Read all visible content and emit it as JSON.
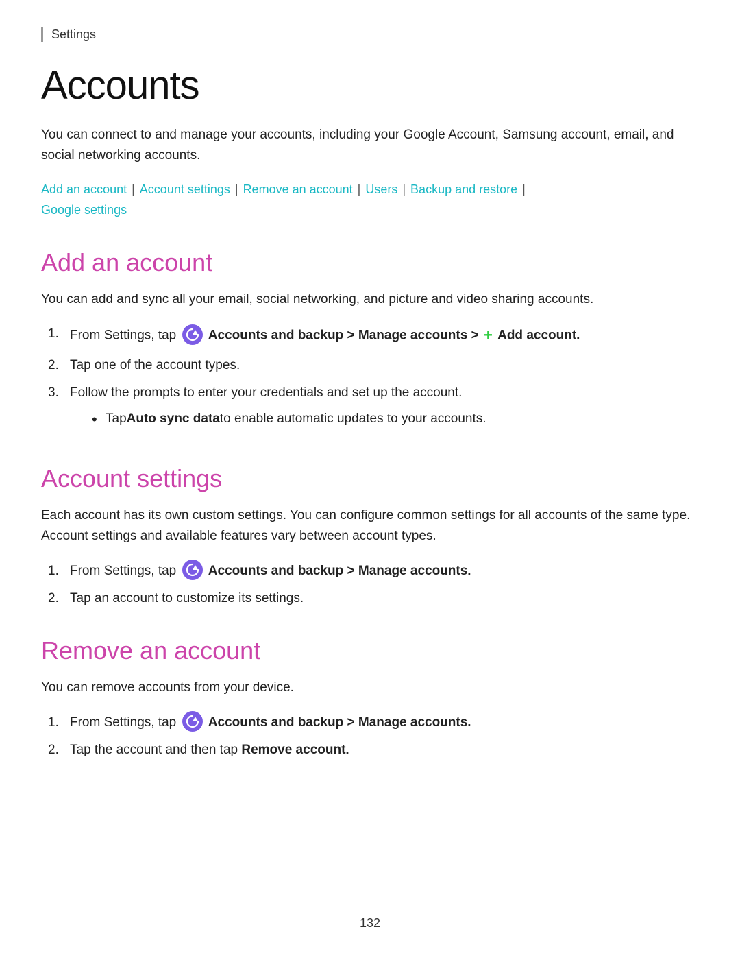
{
  "header": {
    "settings_label": "Settings"
  },
  "page": {
    "title": "Accounts",
    "description": "You can connect to and manage your accounts, including your Google Account, Samsung account, email, and social networking accounts.",
    "page_number": "132"
  },
  "nav": {
    "links": [
      {
        "label": "Add an account",
        "href": "#add"
      },
      {
        "label": "Account settings",
        "href": "#settings"
      },
      {
        "label": "Remove an account",
        "href": "#remove"
      },
      {
        "label": "Users",
        "href": "#users"
      },
      {
        "label": "Backup and restore",
        "href": "#backup"
      },
      {
        "label": "Google settings",
        "href": "#google"
      }
    ]
  },
  "sections": {
    "add_account": {
      "title": "Add an account",
      "description": "You can add and sync all your email, social networking, and picture and video sharing accounts.",
      "steps": [
        {
          "number": "1.",
          "text_before": "From Settings, tap",
          "bold": "Accounts and backup > Manage accounts >",
          "text_after": "Add account.",
          "has_icon": true,
          "has_plus": true
        },
        {
          "number": "2.",
          "text": "Tap one of the account types."
        },
        {
          "number": "3.",
          "text": "Follow the prompts to enter your credentials and set up the account.",
          "bullet": "Tap Auto sync data to enable automatic updates to your accounts.",
          "bullet_bold": "Auto sync data"
        }
      ]
    },
    "account_settings": {
      "title": "Account settings",
      "description": "Each account has its own custom settings. You can configure common settings for all accounts of the same type. Account settings and available features vary between account types.",
      "steps": [
        {
          "number": "1.",
          "text_before": "From Settings, tap",
          "bold": "Accounts and backup > Manage accounts.",
          "has_icon": true
        },
        {
          "number": "2.",
          "text": "Tap an account to customize its settings."
        }
      ]
    },
    "remove_account": {
      "title": "Remove an account",
      "description": "You can remove accounts from your device.",
      "steps": [
        {
          "number": "1.",
          "text_before": "From Settings, tap",
          "bold": "Accounts and backup > Manage accounts.",
          "has_icon": true
        },
        {
          "number": "2.",
          "text_before": "Tap the account and then tap",
          "bold": "Remove account."
        }
      ]
    }
  }
}
